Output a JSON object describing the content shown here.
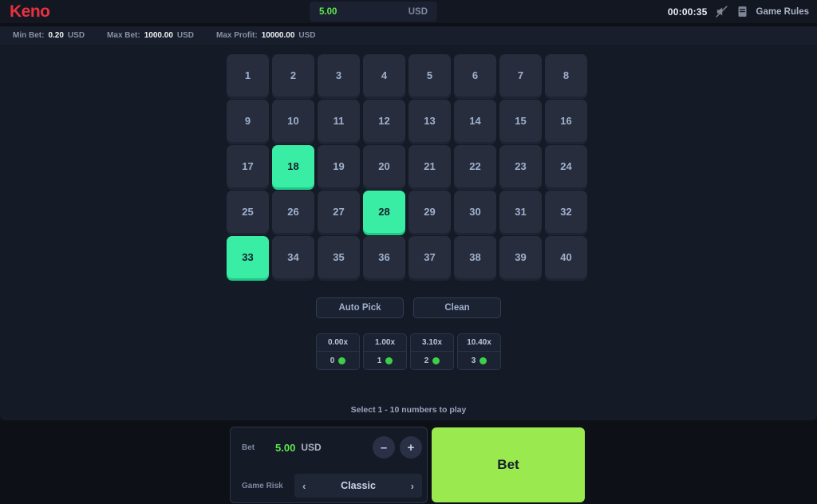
{
  "header": {
    "logo": "Keno",
    "balance": {
      "amount": "5.00",
      "currency": "USD"
    },
    "clock": "00:00:35",
    "sound_icon": "sound-muted-icon",
    "rules_icon": "game-rules-icon",
    "rules_label": "Game Rules"
  },
  "info_bar": [
    {
      "key": "Min Bet:",
      "value": "0.20",
      "unit": "USD"
    },
    {
      "key": "Max Bet:",
      "value": "1000.00",
      "unit": "USD"
    },
    {
      "key": "Max Profit:",
      "value": "10000.00",
      "unit": "USD"
    }
  ],
  "grid": {
    "numbers": [
      1,
      2,
      3,
      4,
      5,
      6,
      7,
      8,
      9,
      10,
      11,
      12,
      13,
      14,
      15,
      16,
      17,
      18,
      19,
      20,
      21,
      22,
      23,
      24,
      25,
      26,
      27,
      28,
      29,
      30,
      31,
      32,
      33,
      34,
      35,
      36,
      37,
      38,
      39,
      40
    ],
    "selected": [
      18,
      28,
      33
    ]
  },
  "actions": {
    "auto_pick": "Auto Pick",
    "clean": "Clean"
  },
  "payouts": [
    {
      "multiplier": "0.00x",
      "hits": "0"
    },
    {
      "multiplier": "1.00x",
      "hits": "1"
    },
    {
      "multiplier": "3.10x",
      "hits": "2"
    },
    {
      "multiplier": "10.40x",
      "hits": "3"
    }
  ],
  "hint": "Select 1 - 10 numbers to play",
  "controls": {
    "bet_label": "Bet",
    "bet_amount": "5.00",
    "bet_currency": "USD",
    "minus": "–",
    "plus": "+",
    "risk_label": "Game Risk",
    "risk_value": "Classic",
    "prev_arrow": "‹",
    "next_arrow": "›"
  },
  "bet_button": "Bet",
  "colors": {
    "brand_red": "#e8313f",
    "selected_green": "#3aeda4",
    "bet_green": "#9ae94f",
    "amount_green": "#5ee84e",
    "dot_green": "#3ecf4a",
    "panel_bg": "#141a26",
    "page_bg": "#0d1117",
    "tile_bg": "#272d3d"
  }
}
